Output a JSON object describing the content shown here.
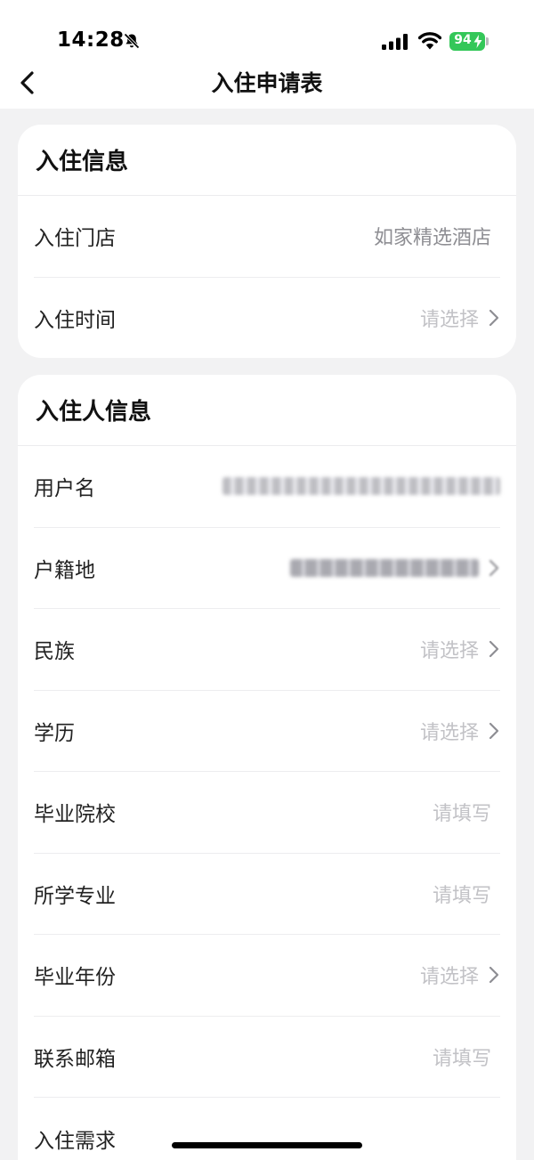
{
  "status_bar": {
    "time": "14:28",
    "battery_level": "94"
  },
  "nav": {
    "title": "入住申请表"
  },
  "checkin_info": {
    "title": "入住信息",
    "rows": [
      {
        "label": "入住门店",
        "value": "如家精选酒店"
      },
      {
        "label": "入住时间",
        "value": "请选择"
      }
    ]
  },
  "guest_info": {
    "title": "入住人信息",
    "rows": [
      {
        "label": "用户名",
        "value": ""
      },
      {
        "label": "户籍地",
        "value": ""
      },
      {
        "label": "民族",
        "value": "请选择"
      },
      {
        "label": "学历",
        "value": "请选择"
      },
      {
        "label": "毕业院校",
        "value": "请填写"
      },
      {
        "label": "所学专业",
        "value": "请填写"
      },
      {
        "label": "毕业年份",
        "value": "请选择"
      },
      {
        "label": "联系邮箱",
        "value": "请填写"
      },
      {
        "label": "入住需求",
        "value": ""
      }
    ]
  },
  "icons": {
    "back": "back-chevron-icon",
    "bell": "bell-slash-icon",
    "signal": "cellular-signal-icon",
    "wifi": "wifi-icon",
    "battery": "battery-charging-icon",
    "row_arrow": "chevron-right-icon"
  },
  "colors": {
    "background": "#f2f2f3",
    "card": "#ffffff",
    "battery": "#34c759",
    "placeholder": "#c2c2c6",
    "value": "#8e8e93"
  }
}
